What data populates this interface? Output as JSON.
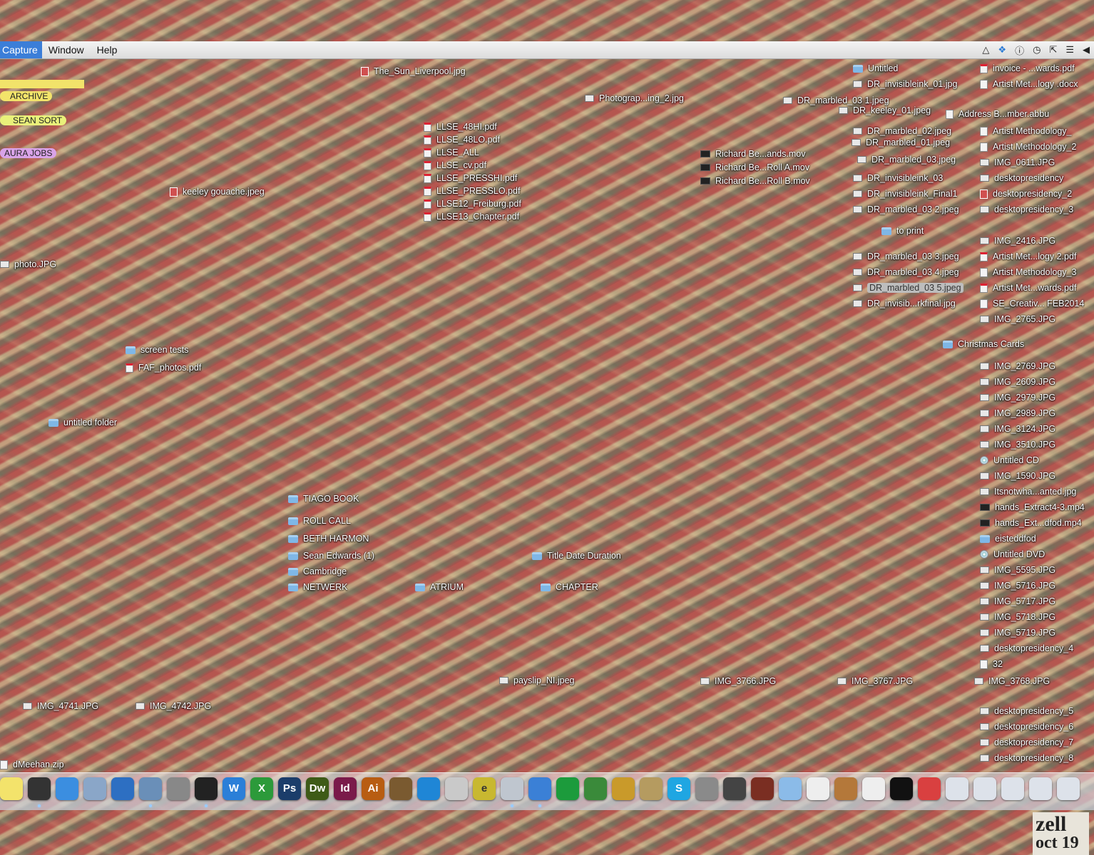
{
  "menubar": {
    "app_name": "Capture",
    "items": [
      "Window",
      "Help"
    ]
  },
  "tags": [
    "ARCHIVE",
    "SEAN SORT",
    "AURA JOBS"
  ],
  "desktop_icons": [
    {
      "label": "The_Sun_Liverpool.jpg",
      "icon": "red-image-icon"
    },
    {
      "label": "Photograp...ing_2.jpg",
      "icon": "image-icon"
    },
    {
      "label": "DR_marbled_03 1.jpeg",
      "icon": "image-icon"
    },
    {
      "label": "Untitled",
      "icon": "folder-icon"
    },
    {
      "label": "invoice - ...wards.pdf",
      "icon": "pdf-icon"
    },
    {
      "label": "DR_invisibleink_01.jpg",
      "icon": "image-icon"
    },
    {
      "label": "Artist Met...logy .docx",
      "icon": "document-icon"
    },
    {
      "label": "DR_keeley_01.jpeg",
      "icon": "image-icon"
    },
    {
      "label": "Address B...mber.abbu",
      "icon": "document-icon"
    },
    {
      "label": "LLSE_48HI.pdf",
      "icon": "pdf-icon"
    },
    {
      "label": "LLSE_48LO.pdf",
      "icon": "pdf-icon"
    },
    {
      "label": "LLSE_ALL",
      "icon": "pdf-icon"
    },
    {
      "label": "LLSE_cv.pdf",
      "icon": "pdf-icon"
    },
    {
      "label": "LLSE_PRESSHI.pdf",
      "icon": "pdf-icon"
    },
    {
      "label": "LLSE_PRESSLO.pdf",
      "icon": "pdf-icon"
    },
    {
      "label": "LLSE12_Freiburg.pdf",
      "icon": "pdf-icon"
    },
    {
      "label": "LLSE13_Chapter.pdf",
      "icon": "pdf-icon"
    },
    {
      "label": "DR_marbled_02.jpeg",
      "icon": "image-icon"
    },
    {
      "label": "Artist Methodology_",
      "icon": "document-icon"
    },
    {
      "label": "DR_marbled_01.jpeg",
      "icon": "image-icon"
    },
    {
      "label": "Artist Methodology_2",
      "icon": "document-icon"
    },
    {
      "label": "Richard Be...ands.mov",
      "icon": "movie-icon"
    },
    {
      "label": "Richard Be...Roll A.mov",
      "icon": "movie-icon"
    },
    {
      "label": "Richard Be...Roll B.mov",
      "icon": "movie-icon"
    },
    {
      "label": "DR_marbled_03.jpeg",
      "icon": "image-icon"
    },
    {
      "label": "IMG_0611.JPG",
      "icon": "image-icon"
    },
    {
      "label": "DR_invisibleink_03",
      "icon": "image-icon"
    },
    {
      "label": "desktopresidency",
      "icon": "image-icon"
    },
    {
      "label": "DR_invisibleink_Final1",
      "icon": "image-icon"
    },
    {
      "label": "desktopresidency_2",
      "icon": "red-image-icon"
    },
    {
      "label": "DR_marbled_03 2.jpeg",
      "icon": "image-icon"
    },
    {
      "label": "desktopresidency_3",
      "icon": "image-icon"
    },
    {
      "label": "keeley gouache.jpeg",
      "icon": "red-image-icon"
    },
    {
      "label": "to print",
      "icon": "folder-icon"
    },
    {
      "label": "IMG_2416.JPG",
      "icon": "image-icon"
    },
    {
      "label": "DR_marbled_03 3.jpeg",
      "icon": "image-icon"
    },
    {
      "label": "Artist Met...logy 2.pdf",
      "icon": "pdf-icon"
    },
    {
      "label": "photo.JPG",
      "icon": "image-icon"
    },
    {
      "label": "DR_marbled_03 4.jpeg",
      "icon": "image-icon"
    },
    {
      "label": "Artist Methodology_3",
      "icon": "document-icon"
    },
    {
      "label": "DR_marbled_03 5.jpeg",
      "icon": "image-icon"
    },
    {
      "label": "Artist Met...wards.pdf",
      "icon": "pdf-icon"
    },
    {
      "label": "DR_invisib...rkfinal.jpg",
      "icon": "image-icon"
    },
    {
      "label": "SE_Creativ... FEB2014",
      "icon": "document-icon"
    },
    {
      "label": "IMG_2765.JPG",
      "icon": "image-icon"
    },
    {
      "label": "Christmas Cards",
      "icon": "folder-icon"
    },
    {
      "label": "screen tests",
      "icon": "folder-icon"
    },
    {
      "label": "FAF_photos.pdf",
      "icon": "pdf-icon"
    },
    {
      "label": "IMG_2769.JPG",
      "icon": "image-icon"
    },
    {
      "label": "IMG_2609.JPG",
      "icon": "image-icon"
    },
    {
      "label": "IMG_2979.JPG",
      "icon": "image-icon"
    },
    {
      "label": "IMG_2989.JPG",
      "icon": "image-icon"
    },
    {
      "label": "untitled folder",
      "icon": "folder-icon"
    },
    {
      "label": "IMG_3124.JPG",
      "icon": "image-icon"
    },
    {
      "label": "IMG_3510.JPG",
      "icon": "image-icon"
    },
    {
      "label": "Untitled CD",
      "icon": "disc-icon"
    },
    {
      "label": "IMG_1590.JPG",
      "icon": "image-icon"
    },
    {
      "label": "Itsnotwha...anted.jpg",
      "icon": "image-icon"
    },
    {
      "label": "TIAGO BOOK",
      "icon": "folder-icon"
    },
    {
      "label": "hands_Extract4-3.mp4",
      "icon": "movie-icon"
    },
    {
      "label": "ROLL CALL",
      "icon": "folder-icon"
    },
    {
      "label": "hands_Ext...dfod.mp4",
      "icon": "movie-icon"
    },
    {
      "label": "BETH HARMON",
      "icon": "folder-icon"
    },
    {
      "label": "eisteddfod",
      "icon": "folder-icon"
    },
    {
      "label": "Sean Edwards (1)",
      "icon": "folder-icon"
    },
    {
      "label": "Title Date Duration",
      "icon": "folder-icon"
    },
    {
      "label": "Untitled DVD",
      "icon": "disc-icon"
    },
    {
      "label": "Cambridge",
      "icon": "folder-icon"
    },
    {
      "label": "IMG_5595.JPG",
      "icon": "image-icon"
    },
    {
      "label": "NETWERK",
      "icon": "folder-icon"
    },
    {
      "label": "ATRIUM",
      "icon": "folder-icon"
    },
    {
      "label": "CHAPTER",
      "icon": "folder-icon"
    },
    {
      "label": "IMG_5716.JPG",
      "icon": "image-icon"
    },
    {
      "label": "IMG_5717.JPG",
      "icon": "image-icon"
    },
    {
      "label": "IMG_5718.JPG",
      "icon": "image-icon"
    },
    {
      "label": "IMG_5719.JPG",
      "icon": "image-icon"
    },
    {
      "label": "desktopresidency_4",
      "icon": "image-icon"
    },
    {
      "label": "32",
      "icon": "document-icon"
    },
    {
      "label": "payslip_NI.jpeg",
      "icon": "image-icon"
    },
    {
      "label": "IMG_3766.JPG",
      "icon": "image-icon"
    },
    {
      "label": "IMG_3767.JPG",
      "icon": "image-icon"
    },
    {
      "label": "IMG_3768.JPG",
      "icon": "image-icon"
    },
    {
      "label": "IMG_4741.JPG",
      "icon": "image-icon"
    },
    {
      "label": "IMG_4742.JPG",
      "icon": "image-icon"
    },
    {
      "label": "desktopresidency_5",
      "icon": "image-icon"
    },
    {
      "label": "desktopresidency_6",
      "icon": "image-icon"
    },
    {
      "label": "desktopresidency_7",
      "icon": "image-icon"
    },
    {
      "label": "desktopresidency_8",
      "icon": "image-icon"
    },
    {
      "label": "dMeehan.zip",
      "icon": "document-icon"
    }
  ],
  "dock": {
    "apps": [
      {
        "icon": "stickies-icon",
        "text": ""
      },
      {
        "icon": "dashboard-icon",
        "text": ""
      },
      {
        "icon": "safari-icon",
        "text": ""
      },
      {
        "icon": "preview-icon",
        "text": ""
      },
      {
        "icon": "thunderbird-icon",
        "text": ""
      },
      {
        "icon": "iphoto-icon",
        "text": ""
      },
      {
        "icon": "screenshot-icon",
        "text": ""
      },
      {
        "icon": "aperture-icon",
        "text": ""
      },
      {
        "icon": "word-icon",
        "text": "W"
      },
      {
        "icon": "excel-icon",
        "text": "X"
      },
      {
        "icon": "photoshop-icon",
        "text": "Ps"
      },
      {
        "icon": "dreamweaver-icon",
        "text": "Dw"
      },
      {
        "icon": "indesign-icon",
        "text": "Id"
      },
      {
        "icon": "illustrator-icon",
        "text": "Ai"
      },
      {
        "icon": "bird-icon",
        "text": ""
      },
      {
        "icon": "quicktime-icon",
        "text": ""
      },
      {
        "icon": "pencil-icon",
        "text": ""
      },
      {
        "icon": "e-icon",
        "text": "e"
      },
      {
        "icon": "mail-icon",
        "text": ""
      },
      {
        "icon": "itunes-icon",
        "text": ""
      },
      {
        "icon": "spotify-icon",
        "text": ""
      },
      {
        "icon": "maps-icon",
        "text": ""
      },
      {
        "icon": "pineapple-icon",
        "text": ""
      },
      {
        "icon": "contacts-icon",
        "text": ""
      },
      {
        "icon": "skype-icon",
        "text": "S"
      },
      {
        "icon": "system-preferences-icon",
        "text": ""
      },
      {
        "icon": "screen-icon",
        "text": ""
      },
      {
        "icon": "book-icon",
        "text": ""
      },
      {
        "icon": "folder-icon",
        "text": ""
      },
      {
        "icon": "docx-icon",
        "text": ""
      },
      {
        "icon": "box-icon",
        "text": ""
      },
      {
        "icon": "calendar-icon",
        "text": ""
      },
      {
        "icon": "phone-icon",
        "text": ""
      },
      {
        "icon": "red-document-icon",
        "text": ""
      },
      {
        "icon": "window-icon",
        "text": ""
      },
      {
        "icon": "window-icon",
        "text": ""
      },
      {
        "icon": "window-icon",
        "text": ""
      },
      {
        "icon": "window-icon",
        "text": ""
      },
      {
        "icon": "window-icon",
        "text": ""
      }
    ]
  },
  "page_fragment": "zell",
  "page_fragment_2": "oct 19"
}
